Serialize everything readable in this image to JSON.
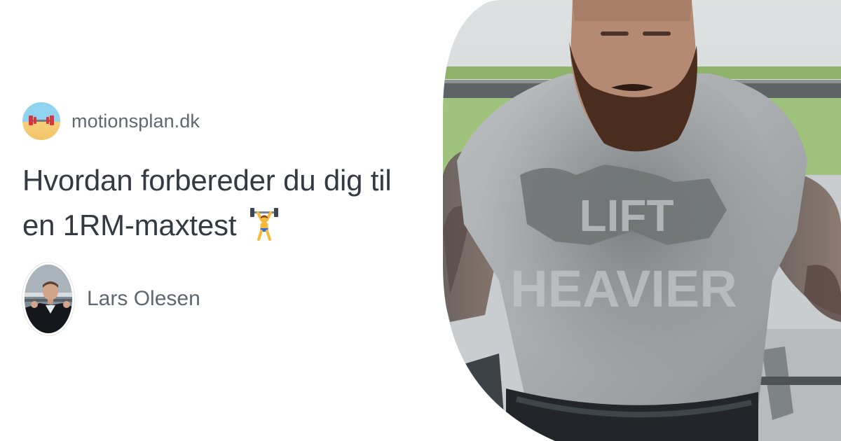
{
  "site": {
    "name": "motionsplan.dk",
    "logo_icon": "barbell-beach-logo"
  },
  "article": {
    "title_line1": "Hvordan forbereder du dig til",
    "title_line2": "en 1RM-maxtest",
    "title_emoji": "person-lifting-weights-icon"
  },
  "author": {
    "name": "Lars Olesen",
    "avatar_icon": "author-avatar"
  },
  "hero_image": {
    "shirt_text_line1": "LIFT",
    "shirt_text_line2": "HEAVIER"
  },
  "colors": {
    "text_muted": "#5f6770",
    "title": "#333a42",
    "background": "#ffffff"
  }
}
